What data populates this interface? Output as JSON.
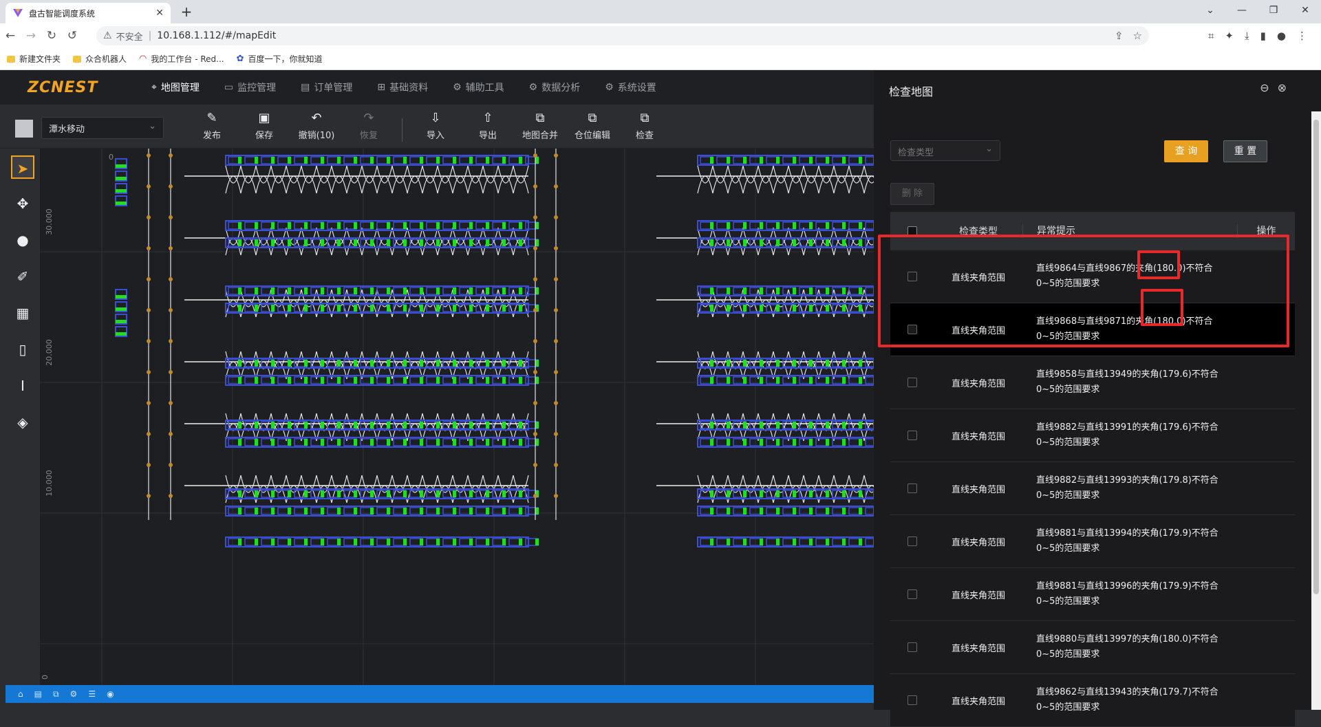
{
  "browser": {
    "tab_title": "盘古智能调度系统",
    "url": "10.168.1.112/#/mapEdit",
    "insecure_label": "不安全",
    "bookmarks": [
      "新建文件夹",
      "众合机器人",
      "我的工作台 - Red...",
      "百度一下，你就知道"
    ]
  },
  "app": {
    "logo": "ZCNEST",
    "nav": [
      "地图管理",
      "监控管理",
      "订单管理",
      "基础资料",
      "辅助工具",
      "数据分析",
      "系统设置"
    ],
    "mode_select": "潭水移动",
    "tools": [
      "发布",
      "保存",
      "撤销(10)",
      "恢复",
      "导入",
      "导出",
      "地图合并",
      "仓位编辑",
      "检查"
    ],
    "ruler": {
      "x0": "0",
      "y1": "30.000",
      "y2": "20.000",
      "y3": "10.000",
      "y4": "0"
    }
  },
  "panel": {
    "title": "检查地图",
    "filter_placeholder": "检查类型",
    "query_label": "查 询",
    "reset_label": "重 置",
    "delete_label": "删 除",
    "columns": {
      "type": "检查类型",
      "message": "异常提示",
      "op": "操作"
    },
    "rows": [
      {
        "type": "直线夹角范围",
        "line1": "直线9864与直线9867的夹角(180.0)不符合",
        "line2": "0~5的范围要求"
      },
      {
        "type": "直线夹角范围",
        "line1": "直线9868与直线9871的夹角(180.0)不符合",
        "line2": "0~5的范围要求"
      },
      {
        "type": "直线夹角范围",
        "line1": "直线9858与直线13949的夹角(179.6)不符合",
        "line2": "0~5的范围要求"
      },
      {
        "type": "直线夹角范围",
        "line1": "直线9882与直线13991的夹角(179.6)不符合",
        "line2": "0~5的范围要求"
      },
      {
        "type": "直线夹角范围",
        "line1": "直线9882与直线13993的夹角(179.8)不符合",
        "line2": "0~5的范围要求"
      },
      {
        "type": "直线夹角范围",
        "line1": "直线9881与直线13994的夹角(179.9)不符合",
        "line2": "0~5的范围要求"
      },
      {
        "type": "直线夹角范围",
        "line1": "直线9881与直线13996的夹角(179.9)不符合",
        "line2": "0~5的范围要求"
      },
      {
        "type": "直线夹角范围",
        "line1": "直线9880与直线13997的夹角(180.0)不符合",
        "line2": "0~5的范围要求"
      },
      {
        "type": "直线夹角范围",
        "line1": "直线9862与直线13943的夹角(179.7)不符合",
        "line2": "0~5的范围要求"
      }
    ]
  },
  "colors": {
    "accent": "#f3a521",
    "highlight": "#e8292b",
    "status": "#1478d4",
    "slot": "#3b4fd6",
    "slot_fill": "#22dd22"
  }
}
